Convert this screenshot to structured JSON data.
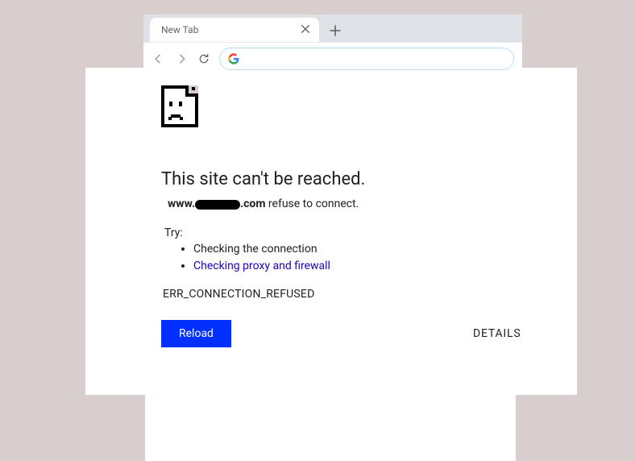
{
  "browser": {
    "tab_title": "New Tab",
    "omnibox_value": "",
    "omnibox_placeholder": ""
  },
  "error": {
    "heading": "This site can't be reached.",
    "site_prefix": "www.",
    "site_suffix": ".com",
    "refuse_text": " refuse to connect.",
    "try_label": "Try:",
    "suggestions": {
      "check_connection": "Checking the connection",
      "check_proxy": "Checking proxy and firewall"
    },
    "code": "ERR_CONNECTION_REFUSED",
    "reload_label": "Reload",
    "details_label": "DETAILS"
  }
}
